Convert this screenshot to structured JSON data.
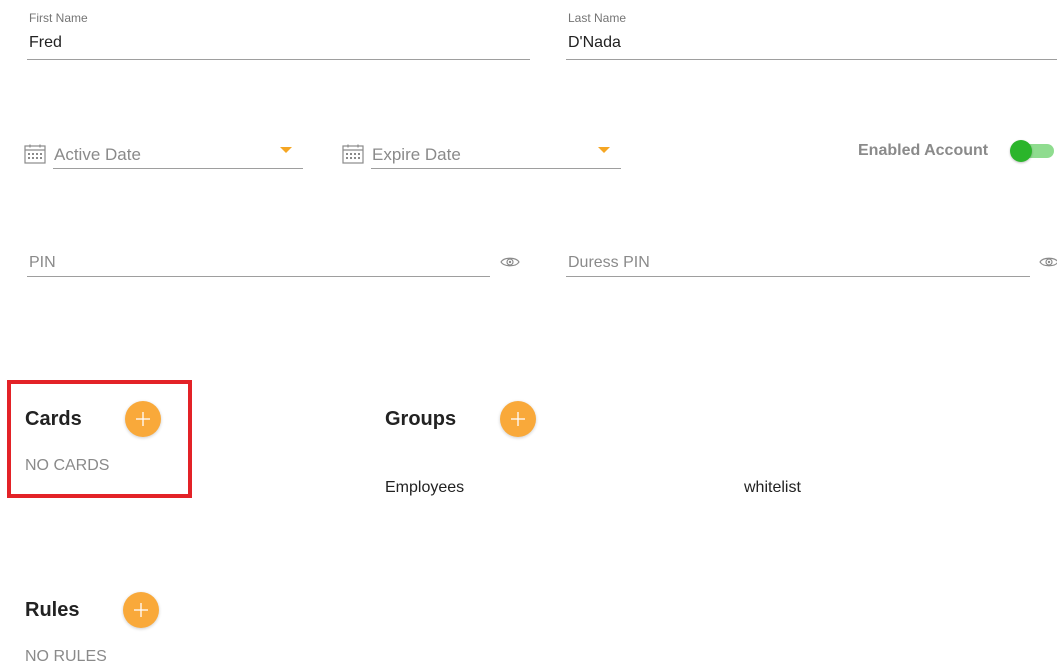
{
  "first_name": {
    "label": "First Name",
    "value": "Fred"
  },
  "last_name": {
    "label": "Last Name",
    "value": "D'Nada"
  },
  "active_date": {
    "placeholder": "Active Date",
    "icon": "calendar-icon"
  },
  "expire_date": {
    "placeholder": "Expire Date",
    "icon": "calendar-icon"
  },
  "enabled_account": {
    "label": "Enabled Account",
    "enabled": true
  },
  "pin": {
    "placeholder": "PIN",
    "icon": "eye-icon"
  },
  "duress_pin": {
    "placeholder": "Duress PIN",
    "icon": "eye-icon"
  },
  "cards": {
    "title": "Cards",
    "empty_text": "NO CARDS",
    "add_icon": "plus-icon"
  },
  "groups": {
    "title": "Groups",
    "add_icon": "plus-icon",
    "items": [
      "Employees",
      "whitelist"
    ]
  },
  "rules": {
    "title": "Rules",
    "empty_text": "NO RULES",
    "add_icon": "plus-icon"
  },
  "colors": {
    "accent": "#f9a93a",
    "toggle_on": "#2bb52b",
    "highlight": "#e32227"
  }
}
